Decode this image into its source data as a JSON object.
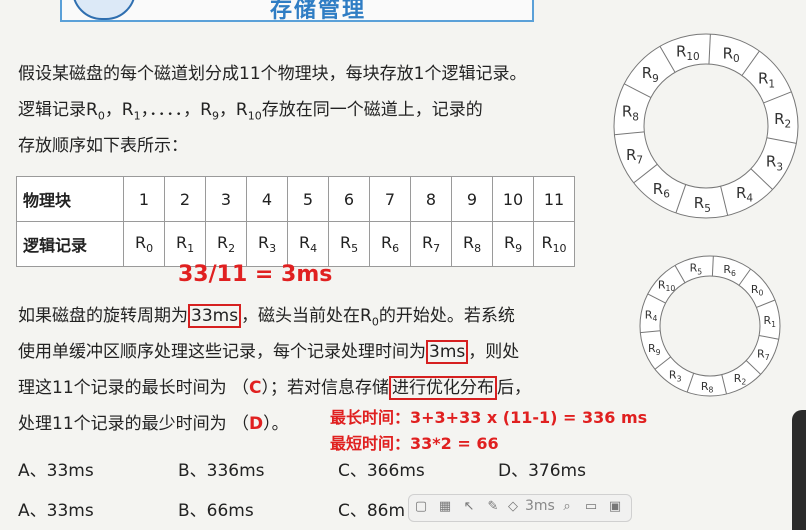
{
  "title": "存储管理",
  "intro": {
    "line1": "假设某磁盘的每个磁道划分成11个物理块，每块存放1个逻辑记录。",
    "line2_pre": "逻辑记录R",
    "line2_r0": "0",
    "line2_sep1": "，R",
    "line2_r1": "1",
    "line2_dots": "，．．．．，R",
    "line2_r9": "9",
    "line2_sep2": "，R",
    "line2_r10": "10",
    "line2_post": "存放在同一个磁道上，记录的",
    "line3": "存放顺序如下表所示："
  },
  "table": {
    "row1_header": "物理块",
    "row2_header": "逻辑记录",
    "blocks": [
      "1",
      "2",
      "3",
      "4",
      "5",
      "6",
      "7",
      "8",
      "9",
      "10",
      "11"
    ],
    "records": [
      {
        "r": "R",
        "s": "0"
      },
      {
        "r": "R",
        "s": "1"
      },
      {
        "r": "R",
        "s": "2"
      },
      {
        "r": "R",
        "s": "3"
      },
      {
        "r": "R",
        "s": "4"
      },
      {
        "r": "R",
        "s": "5"
      },
      {
        "r": "R",
        "s": "6"
      },
      {
        "r": "R",
        "s": "7"
      },
      {
        "r": "R",
        "s": "8"
      },
      {
        "r": "R",
        "s": "9"
      },
      {
        "r": "R",
        "s": "10"
      }
    ]
  },
  "annotation_formula": "33/11 = 3ms",
  "question": {
    "l1_pre": "如果磁盘的旋转周期为",
    "l1_box": "33ms",
    "l1_post1": "，磁头当前处在R",
    "l1_sub": "0",
    "l1_post2": "的开始处。若系统",
    "l2_pre": "使用单缓冲区顺序处理这些记录，每个记录处理时间为",
    "l2_box": "3ms",
    "l2_post": "，则处",
    "l3_pre": "理这11个记录的最长时间为 （",
    "l3_ans": "C",
    "l3_mid": "）；若对信息存储",
    "l3_box": "进行优化分布",
    "l3_post": "后，",
    "l4_pre": "处理11个记录的最少时间为 （",
    "l4_ans": "D",
    "l4_post": "）。"
  },
  "notes": {
    "max": "最长时间：3+3+33 x (11-1) = 336 ms",
    "min": "最短时间：33*2 = 66"
  },
  "options_row1": [
    "A、33ms",
    "B、336ms",
    "C、366ms",
    "D、376ms"
  ],
  "options_row2": [
    "A、33ms",
    "B、66ms",
    "C、86m"
  ],
  "disk_top": [
    "R10",
    "R0",
    "R1",
    "R2",
    "R3",
    "R4",
    "R5",
    "R6",
    "R7",
    "R8",
    "R9"
  ],
  "disk_bottom": [
    "R5",
    "R6",
    "R0",
    "R1",
    "R7",
    "R2",
    "R8",
    "R3",
    "R9",
    "R4",
    "R10"
  ],
  "toolbar": {
    "label": "3ms",
    "icons": [
      "screen-icon",
      "layout-icon",
      "pointer-icon",
      "pen-icon",
      "eraser-icon",
      "search-icon",
      "comment-icon",
      "present-icon"
    ]
  }
}
